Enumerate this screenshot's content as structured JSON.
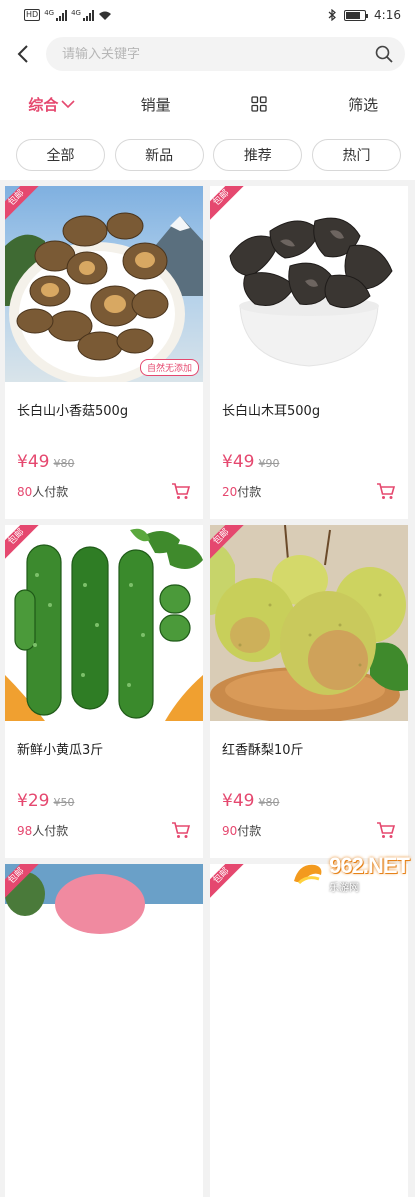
{
  "status_bar": {
    "network_badge": "HD",
    "gen1": "4G",
    "gen2": "4G",
    "time": "4:16"
  },
  "search": {
    "placeholder": "请输入关键字"
  },
  "sort_bar": {
    "comprehensive": "综合",
    "sales": "销量",
    "filter": "筛选"
  },
  "tags": [
    "全部",
    "新品",
    "推荐",
    "热门"
  ],
  "products": [
    {
      "ribbon": "包邮",
      "title": "长白山小香菇500g",
      "price": "¥49",
      "original_price": "¥80",
      "paid_count": "80",
      "paid_suffix": "人付款",
      "image_badge": "自然无添加"
    },
    {
      "ribbon": "包邮",
      "title": "长白山木耳500g",
      "price": "¥49",
      "original_price": "¥90",
      "paid_count": "20",
      "paid_suffix": "付款"
    },
    {
      "ribbon": "包邮",
      "title": "新鲜小黄瓜3斤",
      "price": "¥29",
      "original_price": "¥50",
      "paid_count": "98",
      "paid_suffix": "人付款"
    },
    {
      "ribbon": "包邮",
      "title": "红香酥梨10斤",
      "price": "¥49",
      "original_price": "¥80",
      "paid_count": "90",
      "paid_suffix": "付款"
    },
    {
      "ribbon": "包邮"
    },
    {
      "ribbon": "包邮"
    }
  ],
  "watermark": {
    "main": "962.NET",
    "sub": "乐游网"
  },
  "colors": {
    "accent": "#e5486f"
  }
}
